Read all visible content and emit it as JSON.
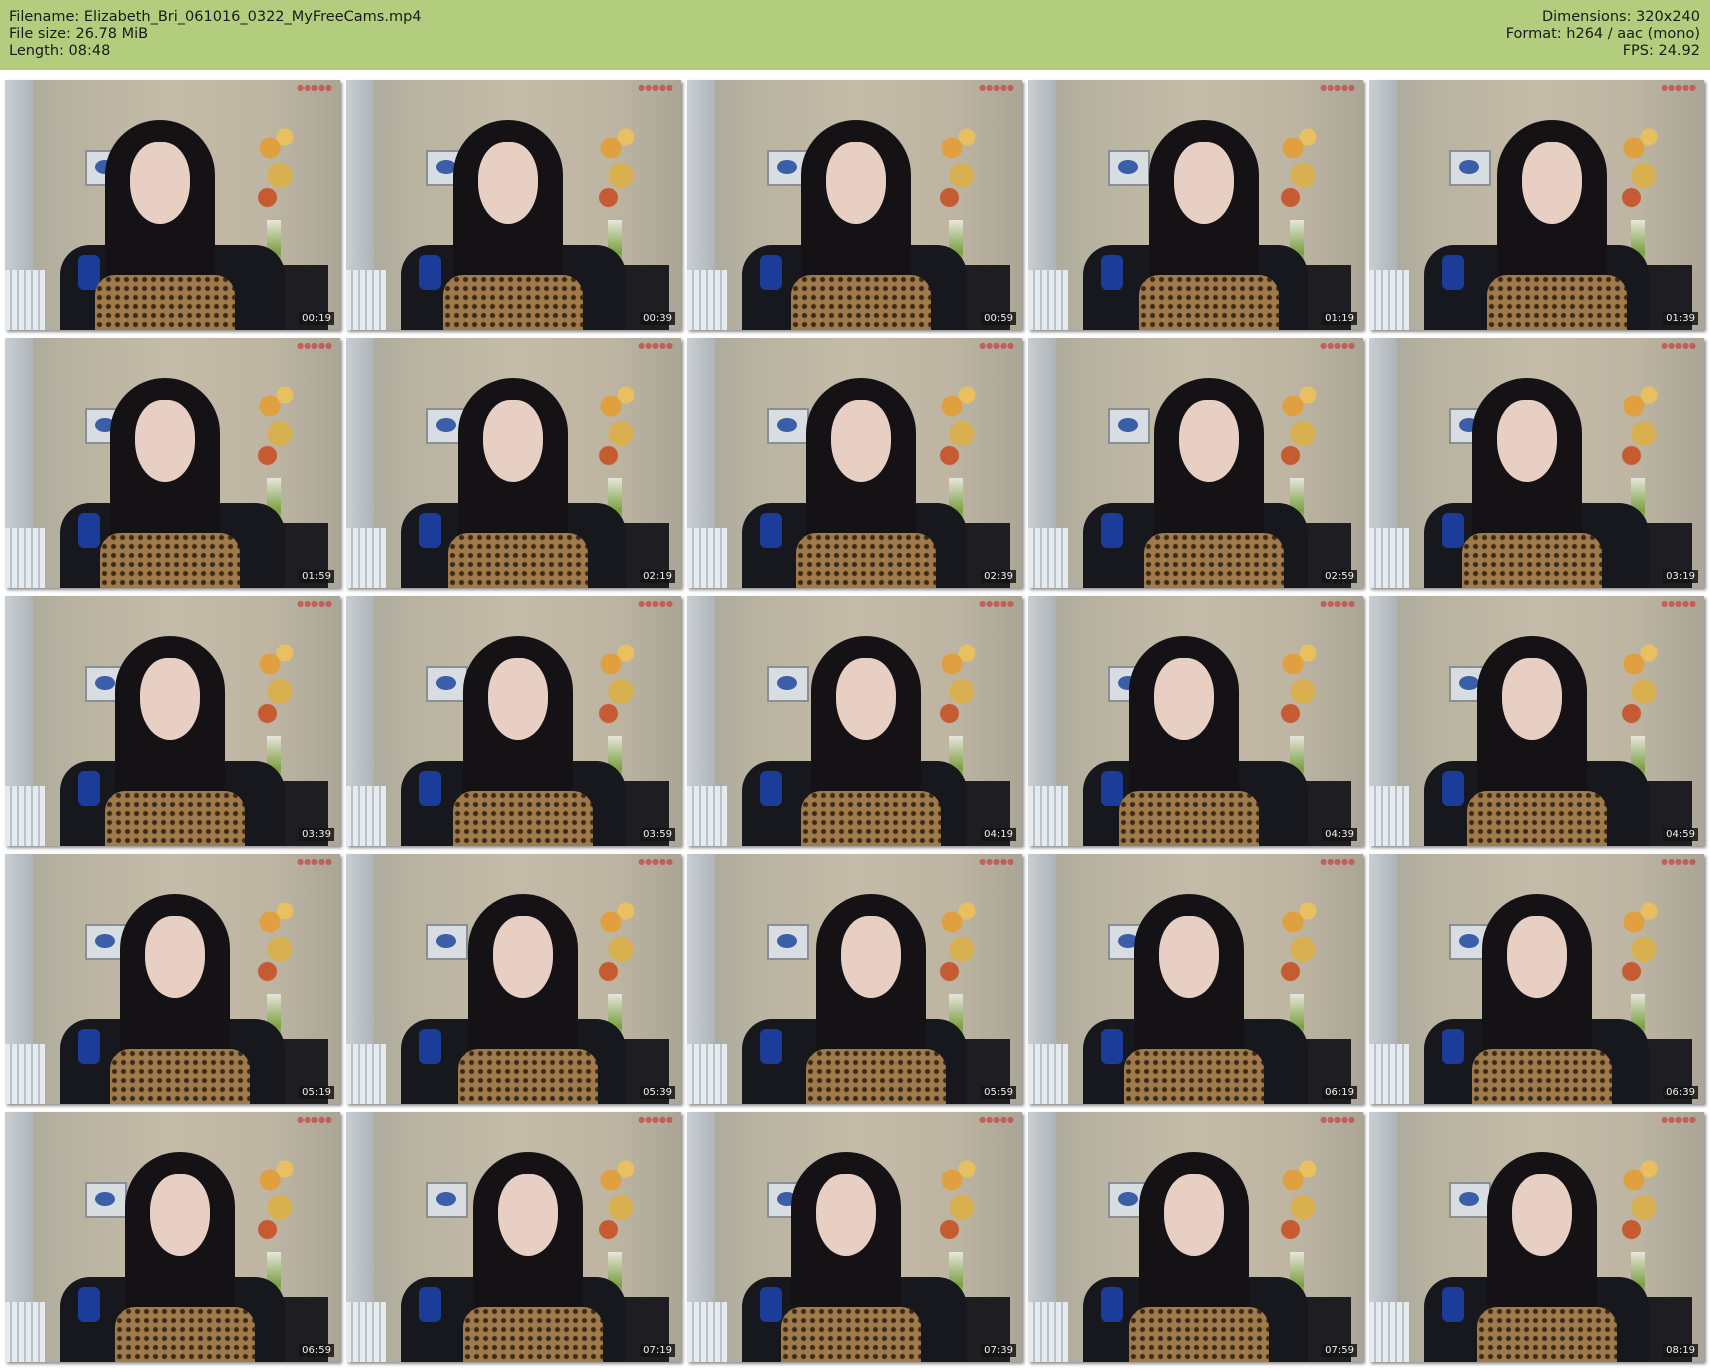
{
  "header": {
    "filename": "Filename: Elizabeth_Bri_061016_0322_MyFreeCams.mp4",
    "file_size": "File size: 26.78 MiB",
    "length": "Length: 08:48",
    "dimensions": "Dimensions: 320x240",
    "format": "Format: h264 / aac (mono)",
    "fps": "FPS: 24.92"
  },
  "thumbnails": [
    "00:19",
    "00:39",
    "00:59",
    "01:19",
    "01:39",
    "01:59",
    "02:19",
    "02:39",
    "02:59",
    "03:19",
    "03:39",
    "03:59",
    "04:19",
    "04:39",
    "04:59",
    "05:19",
    "05:39",
    "05:59",
    "06:19",
    "06:39",
    "06:59",
    "07:19",
    "07:39",
    "07:59",
    "08:19"
  ],
  "colors": {
    "header_bg": "#b3cd7e"
  }
}
